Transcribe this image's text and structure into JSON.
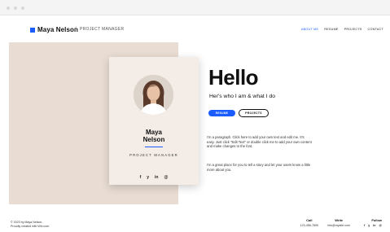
{
  "brand": {
    "name": "Maya Nelson",
    "separator": "/",
    "role": "PROJECT MANAGER",
    "accent": "#1a5cff"
  },
  "nav": [
    {
      "label": "ABOUT ME",
      "active": true
    },
    {
      "label": "RESUME"
    },
    {
      "label": "PROJECTS"
    },
    {
      "label": "CONTACT"
    }
  ],
  "card": {
    "name_line1": "Maya",
    "name_line2": "Nelson",
    "role": "PROJECT MANAGER",
    "socials": [
      "f",
      "y",
      "in",
      "@"
    ]
  },
  "hero": {
    "title": "Hello",
    "tagline": "Her's who I am & what I do"
  },
  "buttons": {
    "resume": "RESUME",
    "projects": "PROJECTS"
  },
  "paragraphs": {
    "p1": "I'm a paragraph. Click here to add your own text and edit me. It's easy. Just click \"Edit Text\" or double click me to add your own content and make changes to the font.",
    "p2": "I'm a great place for you to tell a story and let your users know a little more about you."
  },
  "footer": {
    "copyright_line1": "© 2023 by Maya Nelson.",
    "copyright_line2": "Proudly created with Wix.com",
    "call_label": "Call",
    "phone": "123-456-7890",
    "write_label": "Write",
    "email": "info@mysite.com",
    "follow_label": "Follow",
    "follow_icons": [
      "f",
      "y",
      "in",
      "@"
    ]
  }
}
